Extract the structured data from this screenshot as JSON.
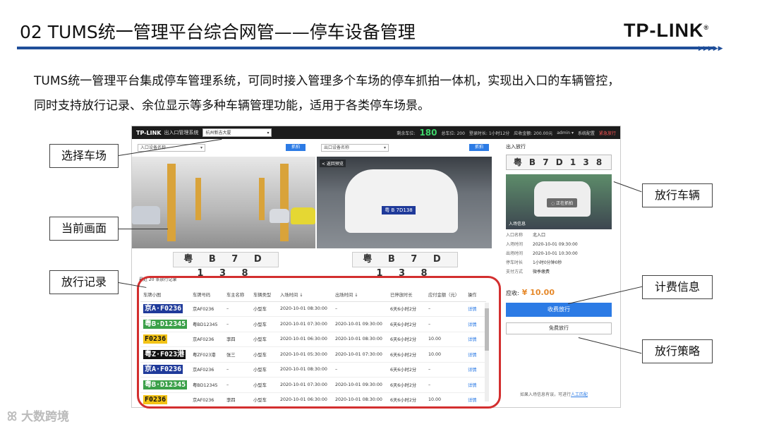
{
  "slide": {
    "title": "02 TUMS统一管理平台综合网管——停车设备管理",
    "logo": "TP-LINK",
    "logo_mark": "®",
    "intro_line1": "TUMS统一管理平台集成停车管理系统，可同时接入管理多个车场的停车抓拍一体机，实现出入口的车辆管控，",
    "intro_line2": "同时支持放行记录、余位显示等多种车辆管理功能，适用于各类停车场景。",
    "watermark": "大数跨境"
  },
  "callouts": {
    "select_lot": "选择车场",
    "current_view": "当前画面",
    "release_records": "放行记录",
    "release_vehicle": "放行车辆",
    "billing_info": "计费信息",
    "release_policy": "放行策略"
  },
  "app": {
    "topbar": {
      "logo": "TP-LINK",
      "system_name": "出入口管理系统",
      "lot_select": "杭州新吉大厦",
      "remaining_label": "剩余车位:",
      "remaining_value": "180",
      "total_label": "总车位: 200",
      "login_time": "登录时长: 1小时12分",
      "receivable": "应收金额: 200.00元",
      "user": "admin",
      "settings": "系统配置",
      "exit": "紧急放行"
    },
    "entry_select": "入口设备名称",
    "entry_btn": "抓拍",
    "exit_select": "出口设备名称",
    "exit_btn": "抓拍",
    "back_label": "< 返回预览",
    "entry_plate": "粤 B 7 D 1 3 8",
    "exit_plate": "粤 B 7 D 1 3 8",
    "exit_car_plate": "粤 B 7D138",
    "records_title": "最近 20 条放行记录",
    "table": {
      "headers": [
        "车牌小图",
        "车牌号码",
        "车主名称",
        "车辆类型",
        "入场时间 ↓",
        "出场时间 ↓",
        "已停放时长",
        "应付金额（元）",
        "操作"
      ],
      "rows": [
        {
          "plate": "京A·F0236",
          "style": "pb",
          "no": "京AF0236",
          "owner": "–",
          "type": "小型车",
          "in": "2020-10-01 08:30:00",
          "out": "–",
          "dur": "6天6小时2分",
          "fee": "–",
          "op": "详情"
        },
        {
          "plate": "粤B·D12345",
          "style": "pg",
          "no": "粤BD12345",
          "owner": "–",
          "type": "小型车",
          "in": "2020-10-01 07:30:00",
          "out": "2020-10-01 09:30:00",
          "dur": "6天6小时2分",
          "fee": "–",
          "op": "详情"
        },
        {
          "plate": "F0236",
          "style": "py",
          "no": "京AF0236",
          "owner": "李四",
          "type": "小型车",
          "in": "2020-10-01 06:30:00",
          "out": "2020-10-01 08:30:00",
          "dur": "6天6小时2分",
          "fee": "10.00",
          "op": "详情"
        },
        {
          "plate": "粤Z·F023港",
          "style": "pk",
          "no": "粤ZF023港",
          "owner": "张三",
          "type": "小型车",
          "in": "2020-10-01 05:30:00",
          "out": "2020-10-01 07:30:00",
          "dur": "6天6小时2分",
          "fee": "10.00",
          "op": "详情"
        },
        {
          "plate": "京A·F0236",
          "style": "pb",
          "no": "京AF0236",
          "owner": "–",
          "type": "小型车",
          "in": "2020-10-01 08:30:00",
          "out": "–",
          "dur": "6天6小时2分",
          "fee": "–",
          "op": "详情"
        },
        {
          "plate": "粤B·D12345",
          "style": "pg",
          "no": "粤BD12345",
          "owner": "–",
          "type": "小型车",
          "in": "2020-10-01 07:30:00",
          "out": "2020-10-01 09:30:00",
          "dur": "6天6小时2分",
          "fee": "–",
          "op": "详情"
        },
        {
          "plate": "F0236",
          "style": "py",
          "no": "京AF0236",
          "owner": "李四",
          "type": "小型车",
          "in": "2020-10-01 06:30:00",
          "out": "2020-10-01 08:30:00",
          "dur": "6天6小时2分",
          "fee": "10.00",
          "op": "详情"
        }
      ]
    },
    "side": {
      "title": "出入放行",
      "plate": "粤 B 7 D 1 3 8",
      "img_label": "入场信息",
      "overlay": "◌ 正在抓拍",
      "fields": [
        {
          "k": "入口名称",
          "v": "北入口"
        },
        {
          "k": "入场时间",
          "v": "2020-10-01 09:30:00"
        },
        {
          "k": "出场时间",
          "v": "2020-10-01 10:30:00"
        },
        {
          "k": "停车时长",
          "v": "1小时0分钟0秒"
        },
        {
          "k": "支付方式",
          "v": "微季缴费"
        }
      ],
      "fee_label": "应收:",
      "fee_value": "¥ 10.00",
      "pay_btn": "收费放行",
      "free_btn": "免费放行",
      "footer": "如果入场信息有误，可进行",
      "footer_link": "人工匹配"
    }
  }
}
